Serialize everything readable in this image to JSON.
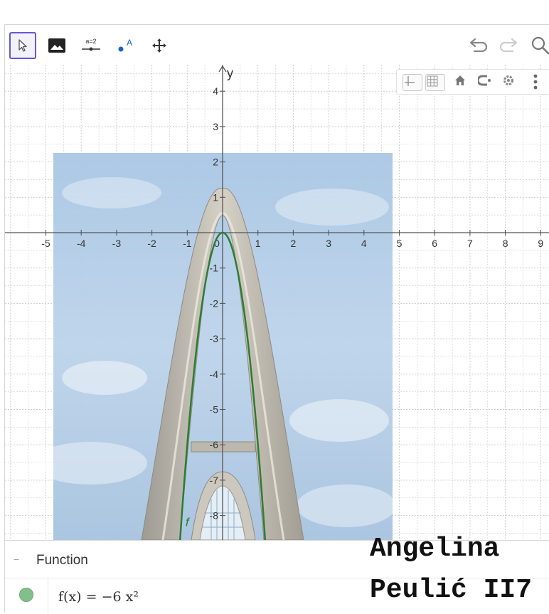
{
  "toolbar": {
    "tools": [
      {
        "name": "move-tool",
        "label": ""
      },
      {
        "name": "image-tool",
        "label": ""
      },
      {
        "name": "slider-tool",
        "label": "a=2"
      },
      {
        "name": "point-tool",
        "label": "A"
      },
      {
        "name": "move-graphics-view-tool",
        "label": ""
      }
    ]
  },
  "graphics": {
    "axis_x_label": "",
    "axis_y_label": "y",
    "x_ticks": [
      "-5",
      "-4",
      "-3",
      "-2",
      "-1",
      "0",
      "1",
      "2",
      "3",
      "4",
      "5",
      "6",
      "7",
      "8",
      "9"
    ],
    "y_ticks": [
      "4",
      "3",
      "2",
      "1",
      "-1",
      "-2",
      "-3",
      "-4",
      "-5",
      "-6",
      "-7",
      "-8"
    ],
    "curve_label": "f",
    "curve_color": "#2e7d32",
    "function": {
      "a": -6,
      "vertex": [
        0,
        0
      ]
    }
  },
  "algebra": {
    "section_title": "Function",
    "collapse_symbol": "−",
    "expression": "f(x) = −6 x²",
    "dot_color": "#84bf8a"
  },
  "caption": {
    "line1": "Angelina",
    "line2": "Peulić II7"
  },
  "colors": {
    "accent": "#6557d2",
    "grid": "#c9c9c9",
    "axis": "#555555"
  }
}
